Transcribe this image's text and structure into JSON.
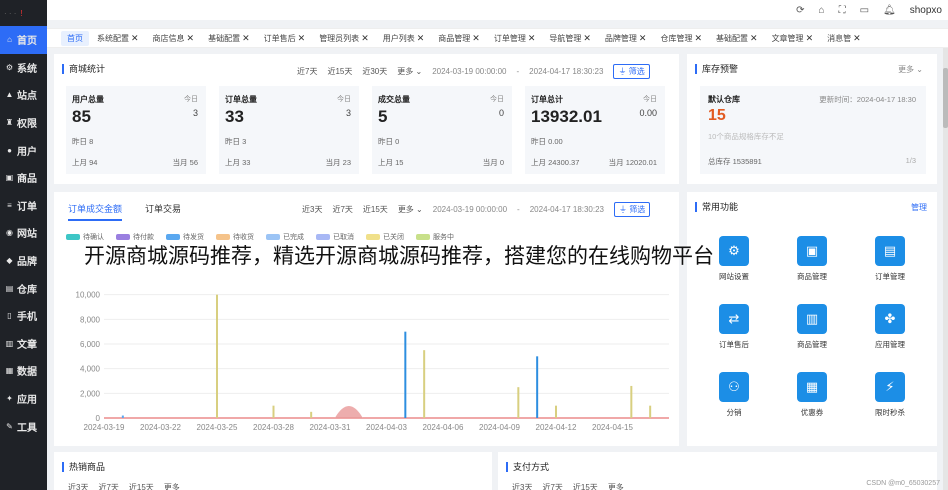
{
  "topbar": {
    "username": "shopxo"
  },
  "sidebar": {
    "items": [
      {
        "label": "首页",
        "icon": "home-icon",
        "glyph": "⌂"
      },
      {
        "label": "系统",
        "icon": "gear-icon",
        "glyph": "⚙"
      },
      {
        "label": "站点",
        "icon": "site-icon",
        "glyph": "▲"
      },
      {
        "label": "权限",
        "icon": "lock-icon",
        "glyph": "♜"
      },
      {
        "label": "用户",
        "icon": "user-icon",
        "glyph": "●"
      },
      {
        "label": "商品",
        "icon": "goods-icon",
        "glyph": "▣"
      },
      {
        "label": "订单",
        "icon": "order-icon",
        "glyph": "≡"
      },
      {
        "label": "网站",
        "icon": "web-icon",
        "glyph": "◉"
      },
      {
        "label": "品牌",
        "icon": "brand-icon",
        "glyph": "◆"
      },
      {
        "label": "仓库",
        "icon": "warehouse-icon",
        "glyph": "▤"
      },
      {
        "label": "手机",
        "icon": "phone-icon",
        "glyph": "▯"
      },
      {
        "label": "文章",
        "icon": "article-icon",
        "glyph": "▥"
      },
      {
        "label": "数据",
        "icon": "data-icon",
        "glyph": "▦"
      },
      {
        "label": "应用",
        "icon": "app-icon",
        "glyph": "✦"
      },
      {
        "label": "工具",
        "icon": "tool-icon",
        "glyph": "✎"
      }
    ]
  },
  "tabs": [
    {
      "label": "首页",
      "active": true
    },
    {
      "label": "系统配置"
    },
    {
      "label": "商店信息"
    },
    {
      "label": "基础配置"
    },
    {
      "label": "订单售后"
    },
    {
      "label": "管理员列表"
    },
    {
      "label": "用户列表"
    },
    {
      "label": "商品管理"
    },
    {
      "label": "订单管理"
    },
    {
      "label": "导航管理"
    },
    {
      "label": "品牌管理"
    },
    {
      "label": "仓库管理"
    },
    {
      "label": "基础配置"
    },
    {
      "label": "文章管理"
    },
    {
      "label": "消息管"
    }
  ],
  "mall_stats": {
    "title": "商城统计",
    "filters": [
      "近7天",
      "近15天",
      "近30天",
      "更多"
    ],
    "date_from": "2024-03-19 00:00:00",
    "date_to": "2024-04-17 18:30:23",
    "filter_button": "筛选",
    "cards": [
      {
        "label": "用户总量",
        "today_label": "今日",
        "total": "85",
        "today": "3",
        "yesterday": "昨日  8",
        "last_month": "上月  94",
        "this_month": "当月  56"
      },
      {
        "label": "订单总量",
        "today_label": "今日",
        "total": "33",
        "today": "3",
        "yesterday": "昨日 3",
        "last_month": "上月  33",
        "this_month": "当月  23"
      },
      {
        "label": "成交总量",
        "today_label": "今日",
        "total": "5",
        "today": "0",
        "yesterday": "昨日 0",
        "last_month": "上月  15",
        "this_month": "当月  0"
      },
      {
        "label": "订单总计",
        "today_label": "今日",
        "total": "13932.01",
        "today": "0.00",
        "yesterday": "昨日 0.00",
        "last_month": "上月  24300.37",
        "this_month": "当月  12020.01"
      }
    ]
  },
  "stock": {
    "title": "库存预警",
    "more": "更多",
    "warehouse": "默认仓库",
    "update_time": "更新时间：2024-04-17 18:30",
    "count": "15",
    "note": "10个商品规格库存不足",
    "stock_label": "总库存  1535891",
    "pager": "1/3"
  },
  "order_chart": {
    "tab_active": "订单成交金额",
    "tab_other": "订单交易",
    "filters": [
      "近3天",
      "近7天",
      "近15天",
      "更多"
    ],
    "date_from": "2024-03-19 00:00:00",
    "date_to": "2024-04-17 18:30:23",
    "filter_button": "筛选"
  },
  "chart_data": {
    "type": "bar",
    "legend": [
      {
        "name": "待确认",
        "color": "#3ec6c6"
      },
      {
        "name": "待付款",
        "color": "#9a7fe0"
      },
      {
        "name": "待发货",
        "color": "#5aa8f0"
      },
      {
        "name": "待收货",
        "color": "#f5c38a"
      },
      {
        "name": "已完成",
        "color": "#9cc4f5"
      },
      {
        "name": "已取消",
        "color": "#a8b8f5"
      },
      {
        "name": "已关闭",
        "color": "#f0e08a"
      },
      {
        "name": "服务中",
        "color": "#c8e08a"
      }
    ],
    "yticks": [
      "0",
      "2,000",
      "4,000",
      "6,000",
      "8,000",
      "10,000"
    ],
    "ylim": [
      0,
      12000
    ],
    "xticks": [
      "2024-03-19",
      "2024-03-22",
      "2024-03-25",
      "2024-03-28",
      "2024-03-31",
      "2024-04-03",
      "2024-04-06",
      "2024-04-09",
      "2024-04-12",
      "2024-04-15"
    ],
    "spikes": [
      {
        "day": 1,
        "value": 200,
        "color": "#5aa8f0"
      },
      {
        "day": 6,
        "value": 10000,
        "color": "#d8cf80"
      },
      {
        "day": 9,
        "value": 1000,
        "color": "#d8cf80"
      },
      {
        "day": 11,
        "value": 500,
        "color": "#d8cf80"
      },
      {
        "day": 16,
        "value": 7000,
        "color": "#2d8ee0"
      },
      {
        "day": 17,
        "value": 5500,
        "color": "#d8cf80"
      },
      {
        "day": 22,
        "value": 2500,
        "color": "#d8cf80"
      },
      {
        "day": 23,
        "value": 5000,
        "color": "#2d8ee0"
      },
      {
        "day": 24,
        "value": 1000,
        "color": "#d8cf80"
      },
      {
        "day": 28,
        "value": 2600,
        "color": "#d8cf80"
      },
      {
        "day": 29,
        "value": 1000,
        "color": "#d8cf80"
      }
    ],
    "hump": {
      "center_day": 13,
      "value": 1300,
      "color": "#e89898"
    }
  },
  "common_functions": {
    "title": "常用功能",
    "manage": "管理",
    "items": [
      {
        "label": "网站设置",
        "icon": "site-settings-icon",
        "glyph": "⚙"
      },
      {
        "label": "商品管理",
        "icon": "goods-manage-icon",
        "glyph": "▣"
      },
      {
        "label": "订单管理",
        "icon": "order-manage-icon",
        "glyph": "▤"
      },
      {
        "label": "订单售后",
        "icon": "after-sale-icon",
        "glyph": "⇄"
      },
      {
        "label": "商品管理",
        "icon": "goods-edit-icon",
        "glyph": "▥"
      },
      {
        "label": "应用管理",
        "icon": "app-manage-icon",
        "glyph": "✤"
      },
      {
        "label": "分销",
        "icon": "distribution-icon",
        "glyph": "⚇"
      },
      {
        "label": "优惠券",
        "icon": "coupon-icon",
        "glyph": "▦"
      },
      {
        "label": "限时秒杀",
        "icon": "flash-sale-icon",
        "glyph": "⚡"
      }
    ]
  },
  "overlay": "开源商城源码推荐，精选开源商城源码推荐，搭建您的在线购物平台",
  "hot_goods": {
    "title": "热销商品",
    "filters": [
      "近3天",
      "近7天",
      "近15天",
      "更多"
    ]
  },
  "payment": {
    "title": "支付方式",
    "filters": [
      "近3天",
      "近7天",
      "近15天",
      "更多"
    ]
  },
  "watermark": "CSDN @m0_65030257"
}
